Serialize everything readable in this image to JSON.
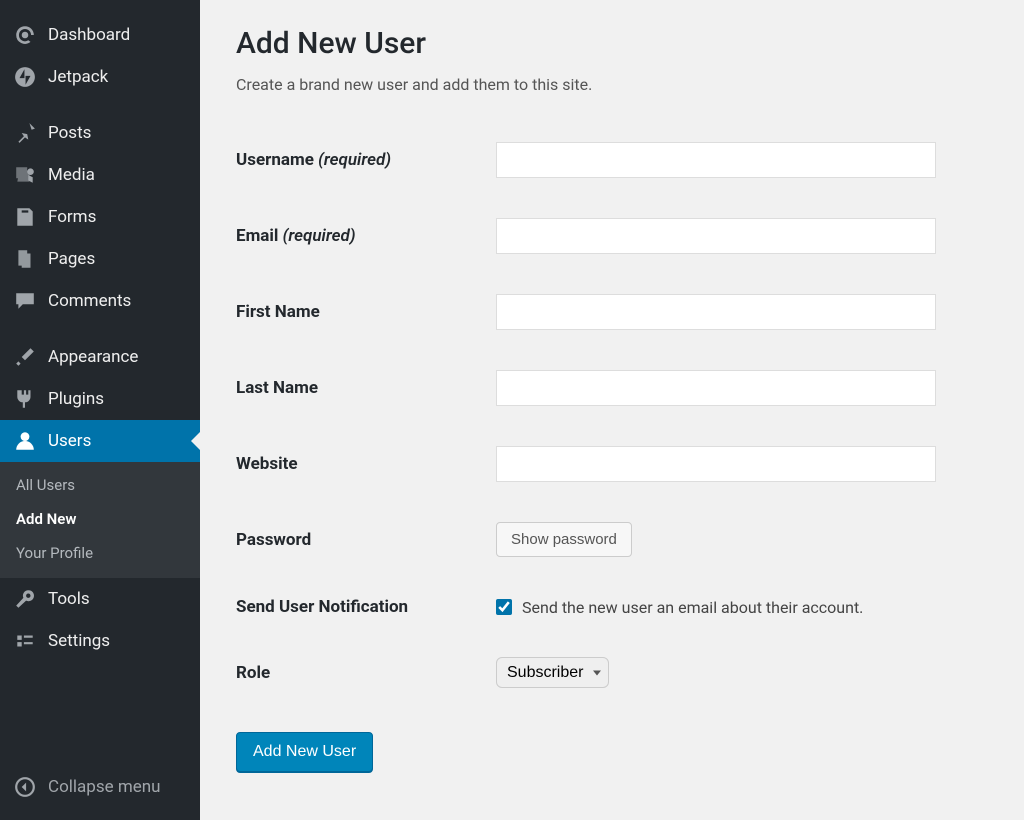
{
  "sidebar": {
    "items": [
      {
        "label": "Dashboard",
        "icon": "dashboard"
      },
      {
        "label": "Jetpack",
        "icon": "jetpack"
      },
      {
        "separator": true
      },
      {
        "label": "Posts",
        "icon": "pin"
      },
      {
        "label": "Media",
        "icon": "media"
      },
      {
        "label": "Forms",
        "icon": "forms"
      },
      {
        "label": "Pages",
        "icon": "pages"
      },
      {
        "label": "Comments",
        "icon": "comment"
      },
      {
        "separator": true
      },
      {
        "label": "Appearance",
        "icon": "brush"
      },
      {
        "label": "Plugins",
        "icon": "plug"
      },
      {
        "label": "Users",
        "icon": "user",
        "active": true
      },
      {
        "label": "Tools",
        "icon": "wrench"
      },
      {
        "label": "Settings",
        "icon": "settings"
      }
    ],
    "submenu": [
      {
        "label": "All Users"
      },
      {
        "label": "Add New",
        "current": true
      },
      {
        "label": "Your Profile"
      }
    ],
    "collapse_label": "Collapse menu"
  },
  "page": {
    "title": "Add New User",
    "description": "Create a brand new user and add them to this site."
  },
  "form": {
    "fields": {
      "username": {
        "label": "Username",
        "required_hint": "(required)",
        "value": ""
      },
      "email": {
        "label": "Email",
        "required_hint": "(required)",
        "value": ""
      },
      "first_name": {
        "label": "First Name",
        "value": ""
      },
      "last_name": {
        "label": "Last Name",
        "value": ""
      },
      "website": {
        "label": "Website",
        "value": ""
      },
      "password": {
        "label": "Password",
        "button_label": "Show password"
      },
      "notification": {
        "label": "Send User Notification",
        "checkbox_label": "Send the new user an email about their account.",
        "checked": true
      },
      "role": {
        "label": "Role",
        "selected": "Subscriber"
      }
    },
    "submit_label": "Add New User"
  }
}
